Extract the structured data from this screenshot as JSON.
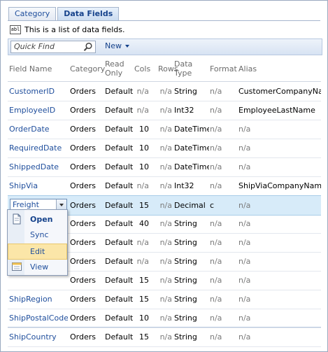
{
  "tabs": [
    {
      "label": "Category",
      "active": false
    },
    {
      "label": "Data Fields",
      "active": true
    }
  ],
  "description": {
    "icon": "abl-field-icon",
    "icon_text": "abl",
    "text": "This is a list of data fields."
  },
  "toolbar": {
    "search_placeholder": "Quick Find",
    "new_label": "New"
  },
  "columns": [
    "Field Name",
    "Category",
    "Read Only",
    "Cols",
    "Rows",
    "Data Type",
    "Format",
    "Alias"
  ],
  "column_lines": [
    [
      "Field Name"
    ],
    [
      "Category"
    ],
    [
      "Read",
      "Only"
    ],
    [
      "Cols"
    ],
    [
      "Rows"
    ],
    [
      "Data",
      "Type"
    ],
    [
      "Format"
    ],
    [
      "Alias"
    ]
  ],
  "rows": [
    {
      "name": "CustomerID",
      "category": "Orders",
      "readonly": "Default",
      "cols": "n/a",
      "rows": "n/a",
      "type": "String",
      "format": "n/a",
      "alias": "CustomerCompanyName"
    },
    {
      "name": "EmployeeID",
      "category": "Orders",
      "readonly": "Default",
      "cols": "n/a",
      "rows": "n/a",
      "type": "Int32",
      "format": "n/a",
      "alias": "EmployeeLastName"
    },
    {
      "name": "OrderDate",
      "category": "Orders",
      "readonly": "Default",
      "cols": "10",
      "rows": "n/a",
      "type": "DateTime",
      "format": "n/a",
      "alias": "n/a"
    },
    {
      "name": "RequiredDate",
      "category": "Orders",
      "readonly": "Default",
      "cols": "10",
      "rows": "n/a",
      "type": "DateTime",
      "format": "n/a",
      "alias": "n/a"
    },
    {
      "name": "ShippedDate",
      "category": "Orders",
      "readonly": "Default",
      "cols": "10",
      "rows": "n/a",
      "type": "DateTime",
      "format": "n/a",
      "alias": "n/a"
    },
    {
      "name": "ShipVia",
      "category": "Orders",
      "readonly": "Default",
      "cols": "n/a",
      "rows": "n/a",
      "type": "Int32",
      "format": "n/a",
      "alias": "ShipViaCompanyName"
    },
    {
      "name": "Freight",
      "category": "Orders",
      "readonly": "Default",
      "cols": "15",
      "rows": "n/a",
      "type": "Decimal",
      "format": "c",
      "alias": "n/a",
      "selected": true
    },
    {
      "name": "",
      "category": "Orders",
      "readonly": "Default",
      "cols": "40",
      "rows": "n/a",
      "type": "String",
      "format": "n/a",
      "alias": "n/a"
    },
    {
      "name": "",
      "category": "Orders",
      "readonly": "Default",
      "cols": "n/a",
      "rows": "n/a",
      "type": "String",
      "format": "n/a",
      "alias": "n/a"
    },
    {
      "name": "",
      "category": "Orders",
      "readonly": "Default",
      "cols": "n/a",
      "rows": "n/a",
      "type": "String",
      "format": "n/a",
      "alias": "n/a"
    },
    {
      "name": "",
      "category": "Orders",
      "readonly": "Default",
      "cols": "15",
      "rows": "n/a",
      "type": "String",
      "format": "n/a",
      "alias": "n/a"
    },
    {
      "name": "ShipRegion",
      "category": "Orders",
      "readonly": "Default",
      "cols": "15",
      "rows": "n/a",
      "type": "String",
      "format": "n/a",
      "alias": "n/a"
    },
    {
      "name": "ShipPostalCode",
      "category": "Orders",
      "readonly": "Default",
      "cols": "10",
      "rows": "n/a",
      "type": "String",
      "format": "n/a",
      "alias": "n/a"
    },
    {
      "name": "ShipCountry",
      "category": "Orders",
      "readonly": "Default",
      "cols": "15",
      "rows": "n/a",
      "type": "String",
      "format": "n/a",
      "alias": "n/a"
    }
  ],
  "context_menu": [
    {
      "label": "Open",
      "icon": "document-icon",
      "bold": true
    },
    {
      "label": "Sync",
      "icon": "",
      "bold": false
    },
    {
      "label": "Edit",
      "icon": "",
      "bold": false,
      "highlighted": true
    },
    {
      "label": "View",
      "icon": "view-form-icon",
      "bold": false
    }
  ]
}
